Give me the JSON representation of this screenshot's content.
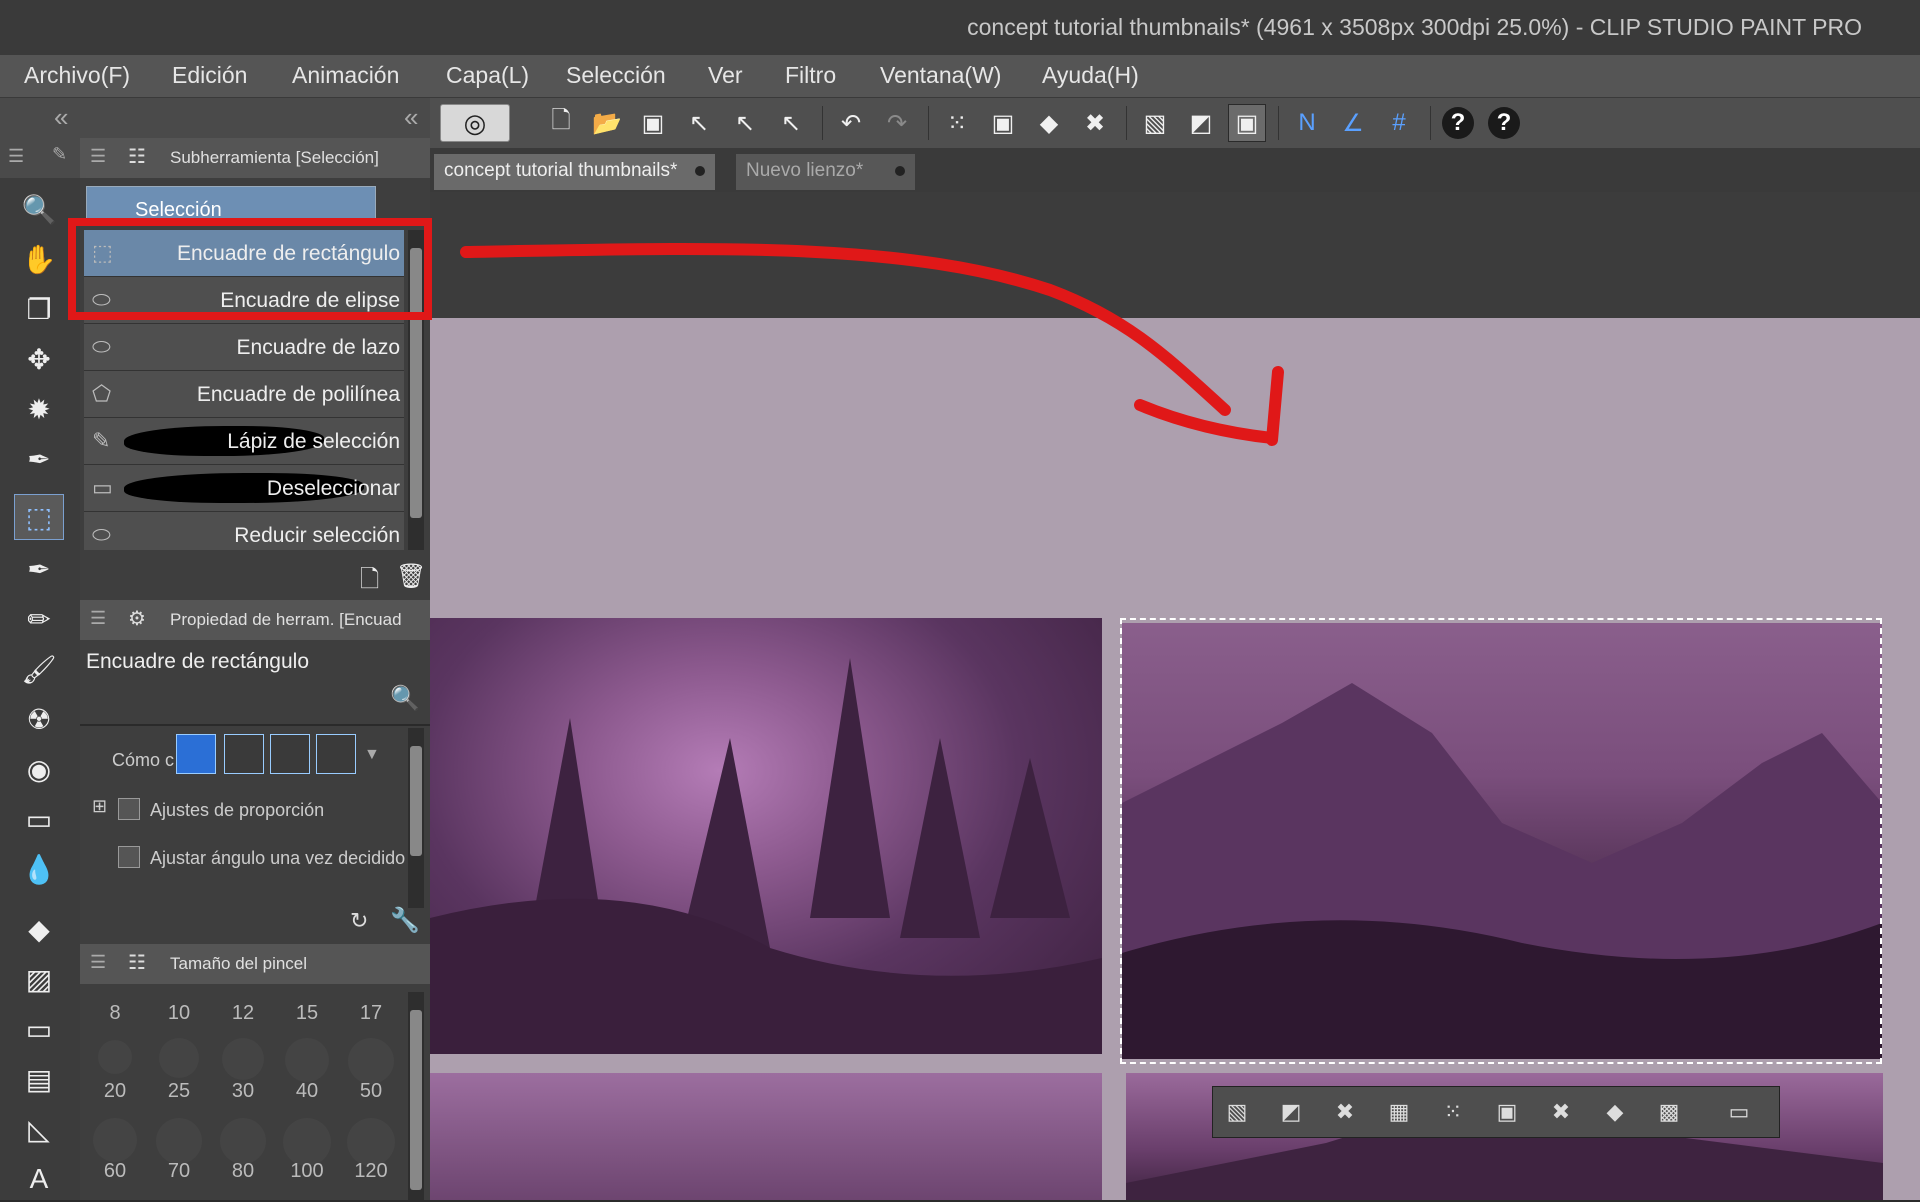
{
  "window": {
    "title": "concept tutorial thumbnails* (4961 x 3508px 300dpi 25.0%)  - CLIP STUDIO PAINT PRO"
  },
  "menu": [
    "Archivo(F)",
    "Edición",
    "Animación",
    "Capa(L)",
    "Selección",
    "Ver",
    "Filtro",
    "Ventana(W)",
    "Ayuda(H)"
  ],
  "toolbar": {
    "icons": [
      "new-file-icon",
      "open-file-icon",
      "save-icon",
      "select-layer-icon",
      "select-layer-add-icon",
      "select-layer-sub-icon",
      "undo-icon",
      "redo-icon",
      "clear-selection-icon",
      "fill-selection-icon",
      "fill-icon",
      "transform-icon",
      "deselect-icon",
      "invert-selection-icon",
      "show-selection-icon",
      "ruler-snap-icon",
      "special-ruler-snap-icon",
      "grid-snap-icon",
      "help-icon",
      "help-icon-2"
    ]
  },
  "subtool_panel": {
    "title": "Subherramienta [Selección]",
    "group_tab": "Selección",
    "items": [
      "Encuadre de rectángulo",
      "Encuadre de elipse",
      "Encuadre de lazo",
      "Encuadre de polilínea",
      "Lápiz de selección",
      "Deseleccionar",
      "Reducir selección"
    ],
    "selected_index": 0
  },
  "property_panel": {
    "title": "Propiedad de herram. [Encuad",
    "tool_name": "Encuadre de rectángulo",
    "row_mode_label": "Cómo c",
    "row_aspect_label": "Ajustes de proporción",
    "row_angle_label": "Ajustar ángulo una vez decidido"
  },
  "brush_size_panel": {
    "title": "Tamaño del pincel",
    "sizes": [
      "8",
      "10",
      "12",
      "15",
      "17",
      "20",
      "25",
      "30",
      "40",
      "50",
      "60",
      "70",
      "80",
      "100",
      "120"
    ]
  },
  "document_tabs": [
    {
      "label": "concept tutorial thumbnails*",
      "active": true
    },
    {
      "label": "Nuevo lienzo*",
      "active": false
    }
  ],
  "colors": {
    "annotation_red": "#e01818",
    "canvas_bg": "#ad9fae",
    "accent_blue": "#2b6fd6"
  }
}
